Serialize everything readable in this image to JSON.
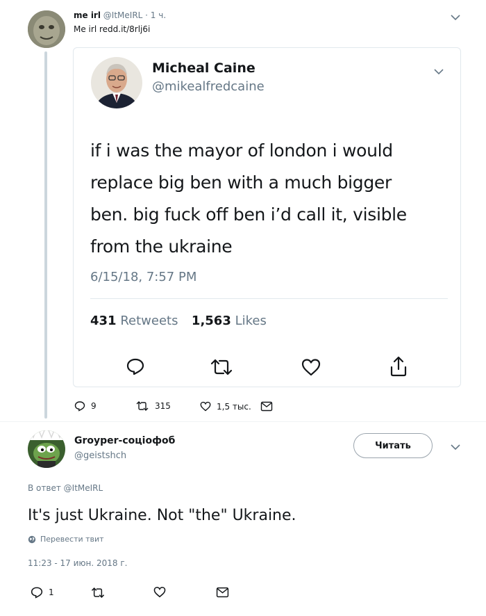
{
  "tweet1": {
    "display_name": "me irl",
    "handle_time": "@ItMeIRL · 1 ч.",
    "text": "Me irl redd.it/8rlj6i",
    "actions": {
      "replies": "9",
      "retweets": "315",
      "likes": "1,5 тыс."
    }
  },
  "quoted": {
    "name": "Micheal Caine",
    "handle": "@mikealfredcaine",
    "lines": [
      "if i was the mayor of london i would",
      "replace big ben with a much bigger",
      "ben. big fuck off ben i’d call it, visible",
      "from the ukraine"
    ],
    "timestamp": "6/15/18, 7:57 PM",
    "retweets_count": "431",
    "retweets_label": "Retweets",
    "likes_count": "1,563",
    "likes_label": "Likes"
  },
  "tweet2": {
    "display_name": "Groyper-соціофоб",
    "handle": "@geistshch",
    "follow_label": "Читать",
    "reply_to_prefix": "В ответ",
    "reply_to_handle": "@ItMeIRL",
    "text": "It's just Ukraine. Not \"the\" Ukraine.",
    "translate_label": "Перевести твит",
    "timestamp": "11:23 - 17 июн. 2018 г.",
    "actions": {
      "replies": "1"
    }
  },
  "colors": {
    "text": "#14171a",
    "muted": "#657786",
    "link": "#1da1f2",
    "thread_line": "#ccd6dd",
    "border": "#e1e8ed"
  },
  "icons": [
    "chevron-down-icon",
    "reply-icon",
    "retweet-icon",
    "like-icon",
    "share-icon",
    "message-icon",
    "globe-icon"
  ]
}
